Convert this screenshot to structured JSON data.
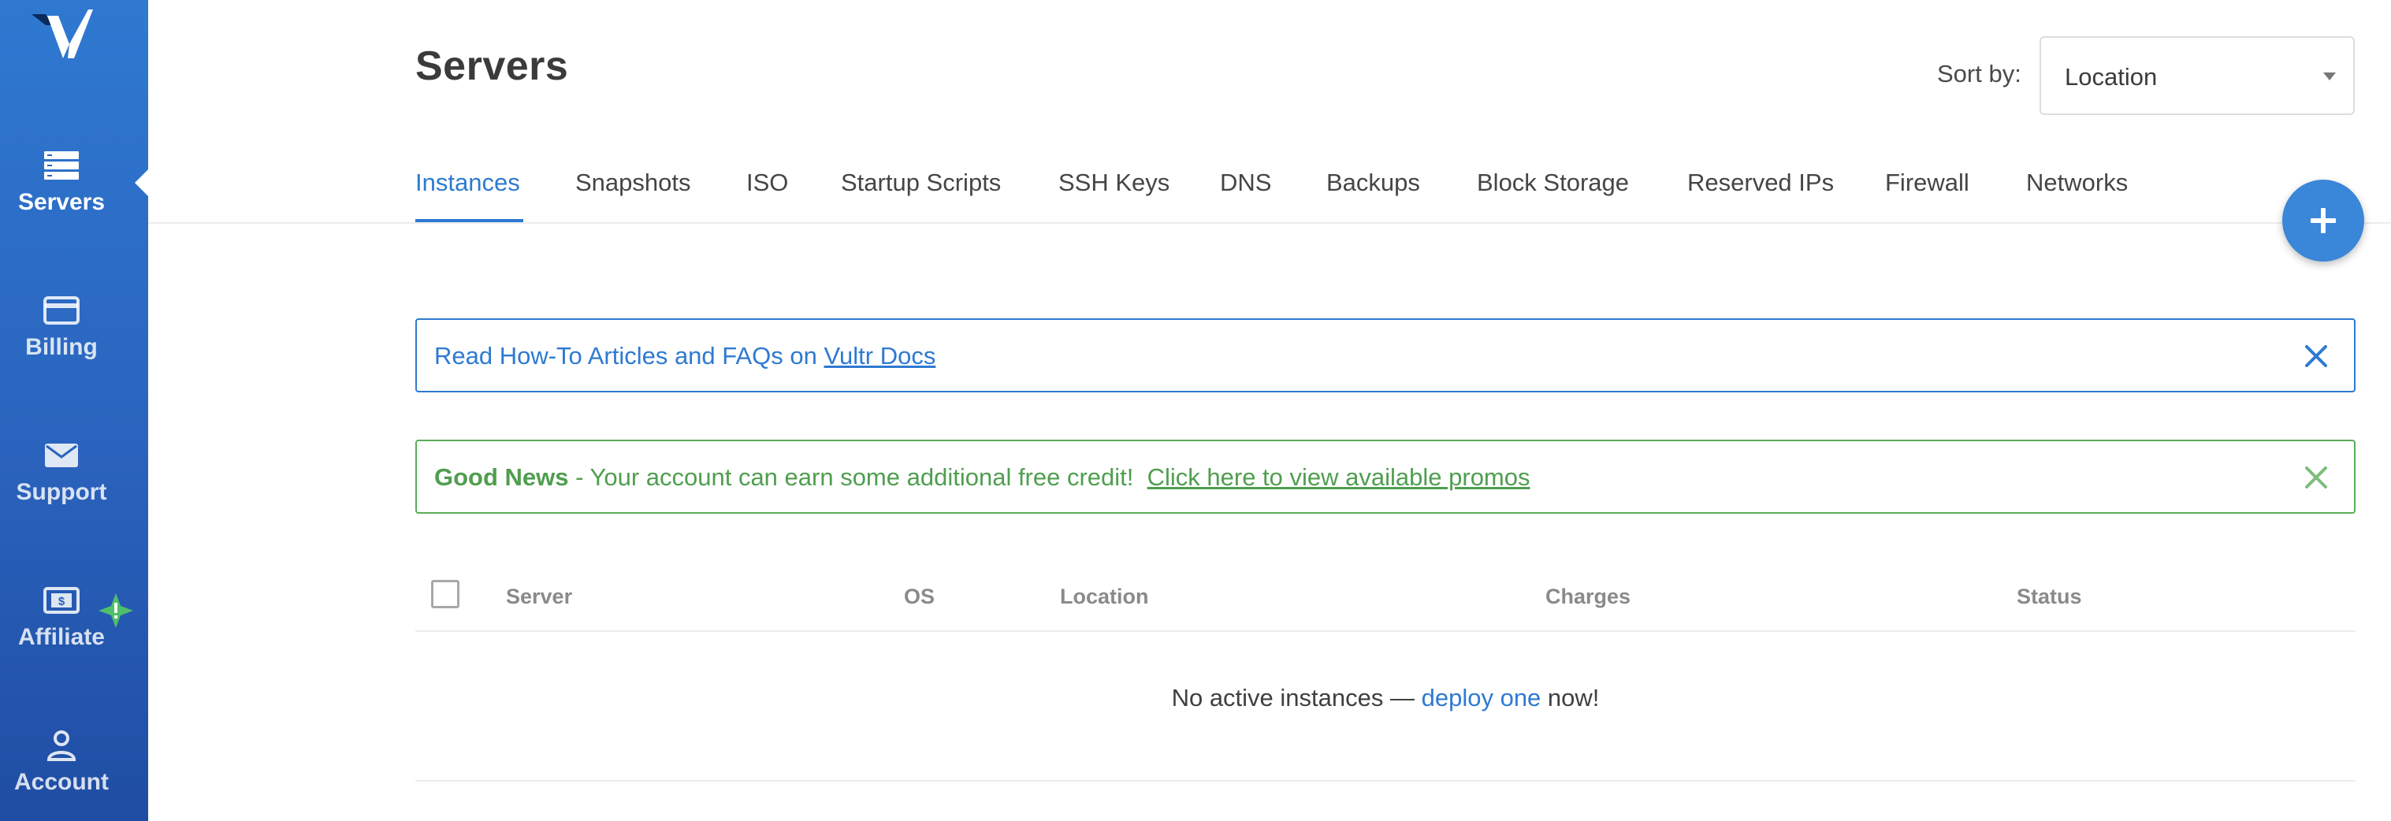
{
  "brand": {
    "logo_icon": "vultr-logo-icon",
    "accent": "#2e7ad1",
    "sidebar_color": "#2a63bd"
  },
  "sidebar": {
    "items": [
      {
        "label": "Servers",
        "icon": "server-icon",
        "active": true
      },
      {
        "label": "Billing",
        "icon": "credit-card-icon",
        "active": false
      },
      {
        "label": "Support",
        "icon": "envelope-icon",
        "active": false
      },
      {
        "label": "Affiliate",
        "icon": "dollar-bill-icon",
        "badge_icon": "alert-star-icon",
        "active": false
      },
      {
        "label": "Account",
        "icon": "user-icon",
        "active": false
      }
    ]
  },
  "header": {
    "title": "Servers",
    "sort_label": "Sort by:",
    "sort_value": "Location"
  },
  "tabs": [
    {
      "label": "Instances",
      "active": true
    },
    {
      "label": "Snapshots"
    },
    {
      "label": "ISO"
    },
    {
      "label": "Startup Scripts"
    },
    {
      "label": "SSH Keys"
    },
    {
      "label": "DNS"
    },
    {
      "label": "Backups"
    },
    {
      "label": "Block Storage"
    },
    {
      "label": "Reserved IPs"
    },
    {
      "label": "Firewall"
    },
    {
      "label": "Networks"
    }
  ],
  "fab": {
    "icon": "plus-icon"
  },
  "notices": {
    "info": {
      "text": "Read How-To Articles and FAQs on ",
      "link": "Vultr Docs",
      "color": "#2e7ad1"
    },
    "good_news": {
      "bold": "Good News",
      "text": " - Your account can earn some additional free credit!  ",
      "link": "Click here to view available promos",
      "color": "#5aac5a"
    }
  },
  "table": {
    "columns": [
      "Server",
      "OS",
      "Location",
      "Charges",
      "Status"
    ],
    "empty": {
      "before": "No active instances — ",
      "link": "deploy one",
      "after": " now!"
    }
  }
}
